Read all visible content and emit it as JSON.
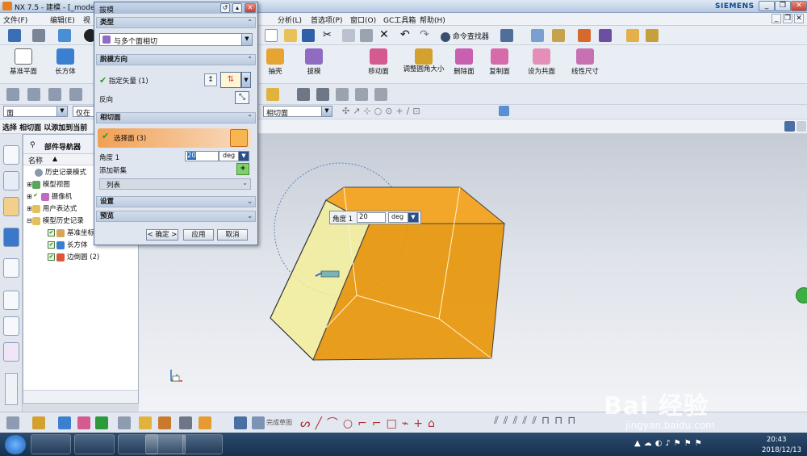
{
  "titlebar": {
    "app_title": "NX 7.5 - 建模 - [_mode",
    "brand": "SIEMENS",
    "buttons": [
      "_",
      "❐",
      "✕"
    ]
  },
  "menubar": {
    "items": [
      "文件(F)",
      "编辑(E)",
      "视",
      "分析(L)",
      "首选项(P)",
      "窗口(O)",
      "GC工具箱",
      "帮助(H)"
    ],
    "mdi_buttons": [
      "_",
      "❐",
      "✕"
    ]
  },
  "toolbar1": {
    "command_finder": "命令查找器"
  },
  "toolbar2": {
    "left_buttons": [
      "基准平面",
      "长方体"
    ],
    "mid_buttons": [
      "抽壳",
      "拔模"
    ],
    "right_buttons": [
      "移动面",
      "调整圆角大小",
      "删除面",
      "复制面",
      "设为共面",
      "线性尺寸"
    ]
  },
  "selbar": {
    "filter": "面",
    "scope": "仅在工",
    "curve_rule": "相切面"
  },
  "cuebar": {
    "cue": "选择 相切面 以添加到当前"
  },
  "navigator": {
    "title": "部件导航器",
    "column": "名称",
    "rows": [
      "历史记录模式",
      "模型视图",
      "摄像机",
      "用户表达式",
      "模型历史记录",
      "基准坐标",
      "长方体",
      "边倒圆 (2)"
    ]
  },
  "dialog": {
    "title": "拔模",
    "sections": {
      "type": "类型",
      "draft_direction": "脱模方向",
      "tangent_faces": "相切面",
      "settings": "设置",
      "preview": "预览"
    },
    "type_value": "与多个面相切",
    "specify_vector": "指定矢量 (1)",
    "reverse": "反向",
    "select_face": "选择面 (3)",
    "angle_label": "角度 1",
    "angle_value": "20",
    "angle_unit": "deg",
    "add_new_set": "添加新集",
    "list": "列表",
    "buttons": {
      "ok": "< 确定 >",
      "apply": "应用",
      "cancel": "取消"
    }
  },
  "angle_popup": {
    "label": "角度 1",
    "value": "20",
    "unit": "deg"
  },
  "bottombar": {
    "sketch_finish": "完成草图"
  },
  "taskbar": {
    "time": "20:43",
    "date": "2018/12/13"
  },
  "watermark": {
    "logo": "Bai 经验",
    "url": "jingyan.baidu.com"
  },
  "colors": {
    "model_orange": "#e8960a",
    "draft_yellow": "#f3ef9a",
    "accent_blue": "#2e6fc0"
  }
}
